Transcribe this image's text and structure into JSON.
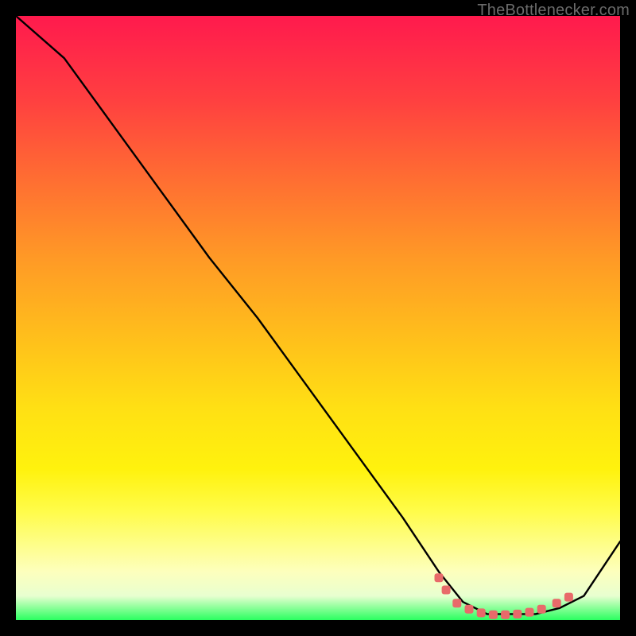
{
  "attribution": "TheBottlenecker.com",
  "chart_data": {
    "type": "line",
    "title": "",
    "xlabel": "",
    "ylabel": "",
    "xlim": [
      0,
      100
    ],
    "ylim": [
      0,
      100
    ],
    "grid": false,
    "curve": {
      "name": "bottleneck-curve",
      "color": "#000000",
      "x": [
        0,
        8,
        16,
        24,
        32,
        40,
        48,
        56,
        64,
        70,
        74,
        78,
        82,
        86,
        90,
        94,
        100
      ],
      "y": [
        100,
        93,
        82,
        71,
        60,
        50,
        39,
        28,
        17,
        8,
        3,
        1,
        1,
        1,
        2,
        4,
        13
      ]
    },
    "markers": {
      "name": "optimal-region",
      "color": "#e86a6a",
      "shape": "rounded-square",
      "x": [
        70.0,
        71.2,
        73.0,
        75.0,
        77.0,
        79.0,
        81.0,
        83.0,
        85.0,
        87.0,
        89.5,
        91.5
      ],
      "y": [
        7.0,
        5.0,
        2.8,
        1.8,
        1.2,
        0.9,
        0.9,
        1.0,
        1.3,
        1.8,
        2.8,
        3.8
      ]
    }
  }
}
